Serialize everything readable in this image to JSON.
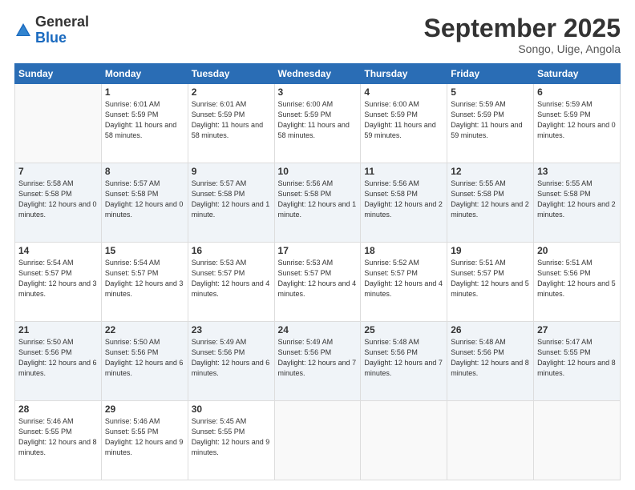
{
  "header": {
    "logo_general": "General",
    "logo_blue": "Blue",
    "month_title": "September 2025",
    "location": "Songo, Uige, Angola"
  },
  "days_of_week": [
    "Sunday",
    "Monday",
    "Tuesday",
    "Wednesday",
    "Thursday",
    "Friday",
    "Saturday"
  ],
  "weeks": [
    [
      {
        "day": "",
        "info": ""
      },
      {
        "day": "1",
        "info": "Sunrise: 6:01 AM\nSunset: 5:59 PM\nDaylight: 11 hours\nand 58 minutes."
      },
      {
        "day": "2",
        "info": "Sunrise: 6:01 AM\nSunset: 5:59 PM\nDaylight: 11 hours\nand 58 minutes."
      },
      {
        "day": "3",
        "info": "Sunrise: 6:00 AM\nSunset: 5:59 PM\nDaylight: 11 hours\nand 58 minutes."
      },
      {
        "day": "4",
        "info": "Sunrise: 6:00 AM\nSunset: 5:59 PM\nDaylight: 11 hours\nand 59 minutes."
      },
      {
        "day": "5",
        "info": "Sunrise: 5:59 AM\nSunset: 5:59 PM\nDaylight: 11 hours\nand 59 minutes."
      },
      {
        "day": "6",
        "info": "Sunrise: 5:59 AM\nSunset: 5:59 PM\nDaylight: 12 hours\nand 0 minutes."
      }
    ],
    [
      {
        "day": "7",
        "info": "Sunrise: 5:58 AM\nSunset: 5:58 PM\nDaylight: 12 hours\nand 0 minutes."
      },
      {
        "day": "8",
        "info": "Sunrise: 5:57 AM\nSunset: 5:58 PM\nDaylight: 12 hours\nand 0 minutes."
      },
      {
        "day": "9",
        "info": "Sunrise: 5:57 AM\nSunset: 5:58 PM\nDaylight: 12 hours\nand 1 minute."
      },
      {
        "day": "10",
        "info": "Sunrise: 5:56 AM\nSunset: 5:58 PM\nDaylight: 12 hours\nand 1 minute."
      },
      {
        "day": "11",
        "info": "Sunrise: 5:56 AM\nSunset: 5:58 PM\nDaylight: 12 hours\nand 2 minutes."
      },
      {
        "day": "12",
        "info": "Sunrise: 5:55 AM\nSunset: 5:58 PM\nDaylight: 12 hours\nand 2 minutes."
      },
      {
        "day": "13",
        "info": "Sunrise: 5:55 AM\nSunset: 5:58 PM\nDaylight: 12 hours\nand 2 minutes."
      }
    ],
    [
      {
        "day": "14",
        "info": "Sunrise: 5:54 AM\nSunset: 5:57 PM\nDaylight: 12 hours\nand 3 minutes."
      },
      {
        "day": "15",
        "info": "Sunrise: 5:54 AM\nSunset: 5:57 PM\nDaylight: 12 hours\nand 3 minutes."
      },
      {
        "day": "16",
        "info": "Sunrise: 5:53 AM\nSunset: 5:57 PM\nDaylight: 12 hours\nand 4 minutes."
      },
      {
        "day": "17",
        "info": "Sunrise: 5:53 AM\nSunset: 5:57 PM\nDaylight: 12 hours\nand 4 minutes."
      },
      {
        "day": "18",
        "info": "Sunrise: 5:52 AM\nSunset: 5:57 PM\nDaylight: 12 hours\nand 4 minutes."
      },
      {
        "day": "19",
        "info": "Sunrise: 5:51 AM\nSunset: 5:57 PM\nDaylight: 12 hours\nand 5 minutes."
      },
      {
        "day": "20",
        "info": "Sunrise: 5:51 AM\nSunset: 5:56 PM\nDaylight: 12 hours\nand 5 minutes."
      }
    ],
    [
      {
        "day": "21",
        "info": "Sunrise: 5:50 AM\nSunset: 5:56 PM\nDaylight: 12 hours\nand 6 minutes."
      },
      {
        "day": "22",
        "info": "Sunrise: 5:50 AM\nSunset: 5:56 PM\nDaylight: 12 hours\nand 6 minutes."
      },
      {
        "day": "23",
        "info": "Sunrise: 5:49 AM\nSunset: 5:56 PM\nDaylight: 12 hours\nand 6 minutes."
      },
      {
        "day": "24",
        "info": "Sunrise: 5:49 AM\nSunset: 5:56 PM\nDaylight: 12 hours\nand 7 minutes."
      },
      {
        "day": "25",
        "info": "Sunrise: 5:48 AM\nSunset: 5:56 PM\nDaylight: 12 hours\nand 7 minutes."
      },
      {
        "day": "26",
        "info": "Sunrise: 5:48 AM\nSunset: 5:56 PM\nDaylight: 12 hours\nand 8 minutes."
      },
      {
        "day": "27",
        "info": "Sunrise: 5:47 AM\nSunset: 5:55 PM\nDaylight: 12 hours\nand 8 minutes."
      }
    ],
    [
      {
        "day": "28",
        "info": "Sunrise: 5:46 AM\nSunset: 5:55 PM\nDaylight: 12 hours\nand 8 minutes."
      },
      {
        "day": "29",
        "info": "Sunrise: 5:46 AM\nSunset: 5:55 PM\nDaylight: 12 hours\nand 9 minutes."
      },
      {
        "day": "30",
        "info": "Sunrise: 5:45 AM\nSunset: 5:55 PM\nDaylight: 12 hours\nand 9 minutes."
      },
      {
        "day": "",
        "info": ""
      },
      {
        "day": "",
        "info": ""
      },
      {
        "day": "",
        "info": ""
      },
      {
        "day": "",
        "info": ""
      }
    ]
  ]
}
